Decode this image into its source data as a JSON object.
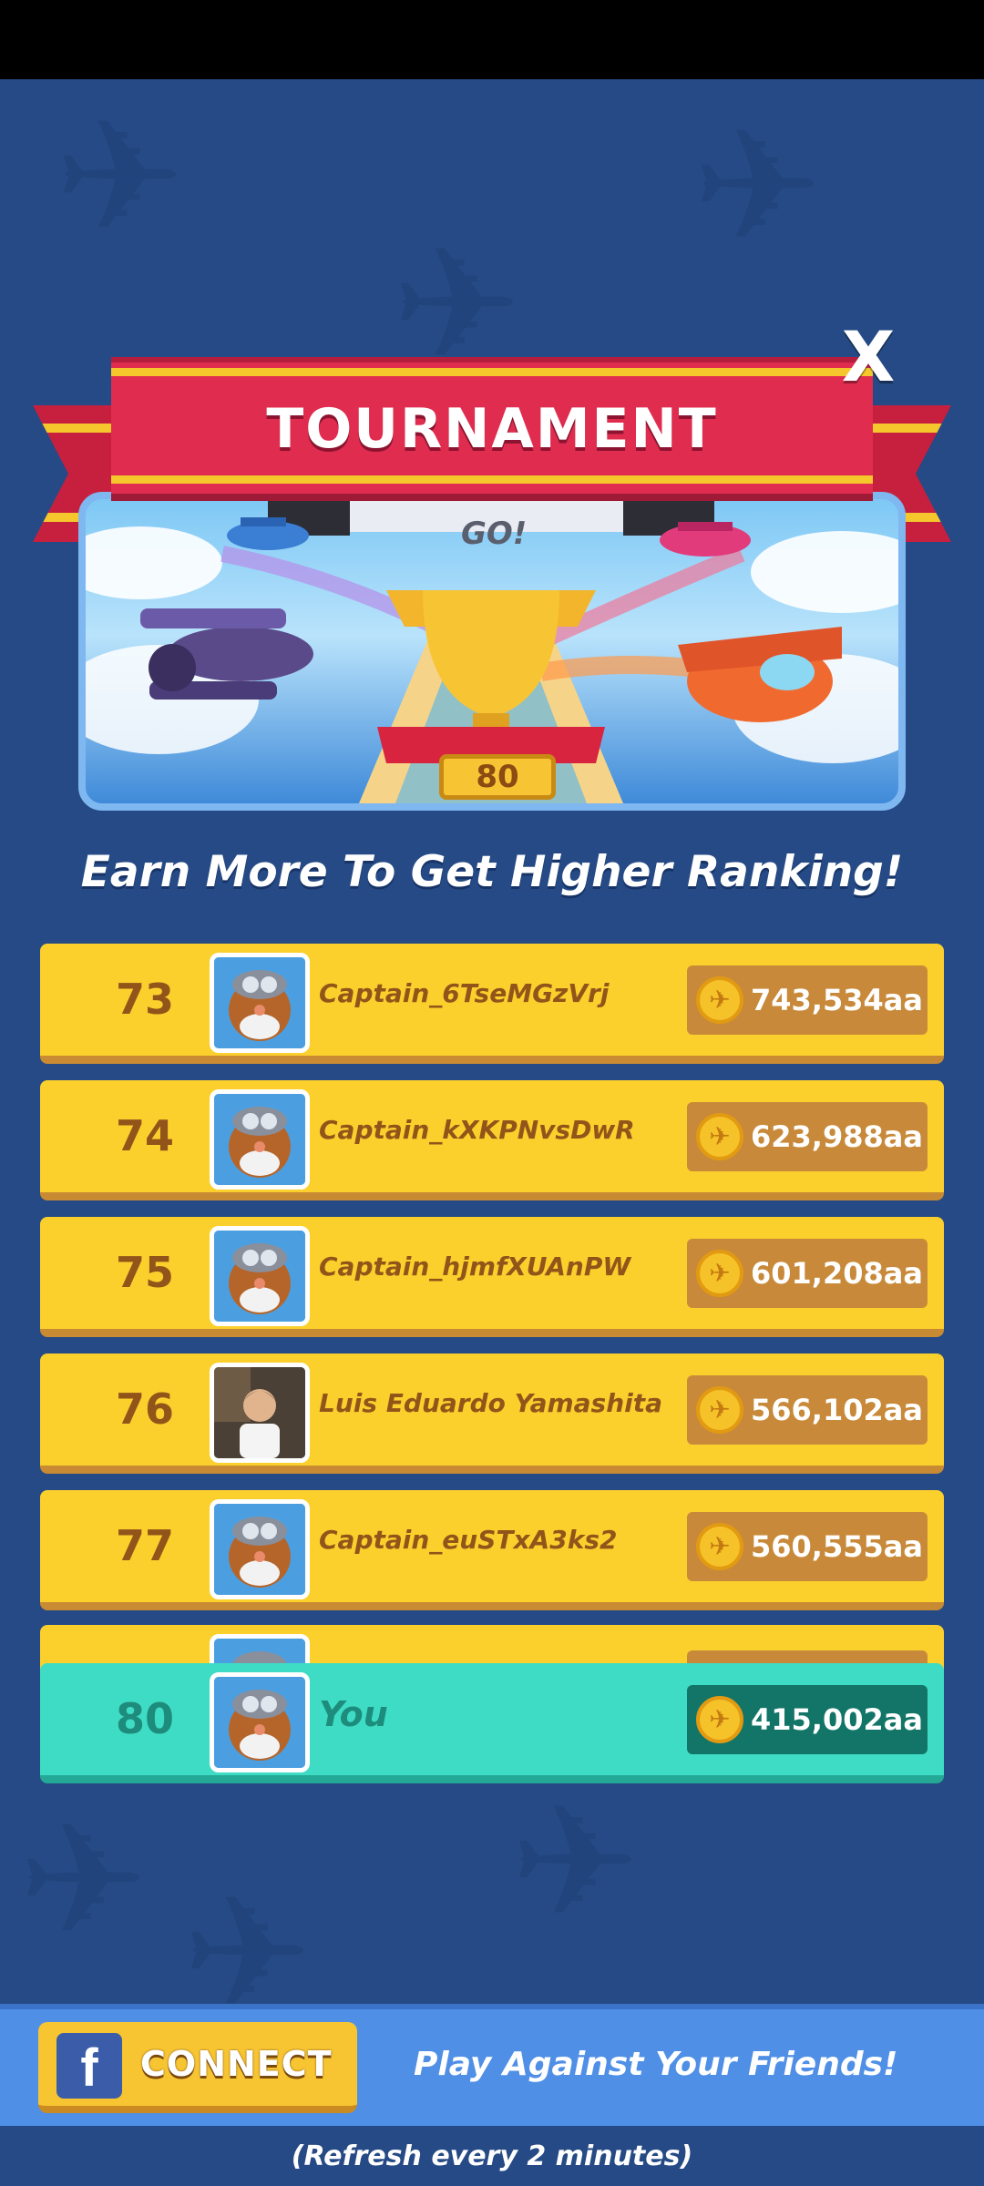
{
  "header": {
    "title": "TOURNAMENT",
    "close_label": "X"
  },
  "banner": {
    "sign_text": "GO!",
    "trophy_level": "80"
  },
  "headline": "Earn More To Get Higher Ranking!",
  "leaderboard": {
    "rows": [
      {
        "rank": "73",
        "name": "Captain_6TseMGzVrj",
        "score": "743,534aa"
      },
      {
        "rank": "74",
        "name": "Captain_kXKPNvsDwR",
        "score": "623,988aa"
      },
      {
        "rank": "75",
        "name": "Captain_hjmfXUAnPW",
        "score": "601,208aa"
      },
      {
        "rank": "76",
        "name": "Luis Eduardo Yamashita",
        "score": "566,102aa"
      },
      {
        "rank": "77",
        "name": "Captain_euSTxA3ks2",
        "score": "560,555aa"
      }
    ],
    "you": {
      "rank": "80",
      "name": "You",
      "score": "415,002aa"
    }
  },
  "footer": {
    "connect_label": "CONNECT",
    "fb_glyph": "f",
    "tagline": "Play Against Your Friends!",
    "refresh_note": "(Refresh every 2 minutes)"
  },
  "colors": {
    "background": "#254a85",
    "ribbon": "#e02c4f",
    "row": "#fbd02d",
    "you_row": "#3fdcc5",
    "footer": "#4f8fe6"
  },
  "icons": {
    "close": "close-icon",
    "coin": "plane-coin-icon",
    "facebook": "facebook-icon",
    "avatar": "pilot-avatar-icon"
  }
}
